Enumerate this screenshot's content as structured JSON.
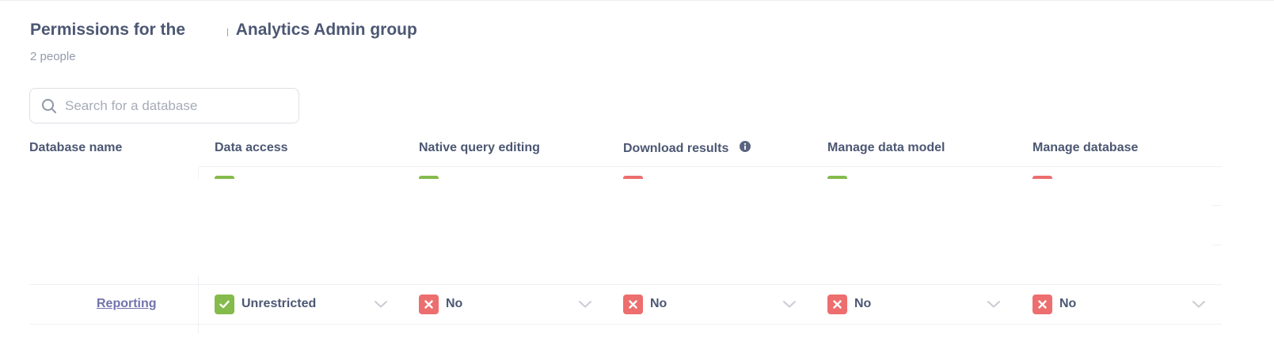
{
  "header": {
    "title_prefix": "Permissions for the",
    "title_group": "Analytics Admin group",
    "subtitle": "2 people"
  },
  "search": {
    "placeholder": "Search for a database",
    "value": ""
  },
  "table": {
    "columns": [
      "Database name",
      "Data access",
      "Native query editing",
      "Download results",
      "Manage data model",
      "Manage database"
    ],
    "partial_row_statuses": [
      "green",
      "green",
      "red",
      "green",
      "red"
    ],
    "rows": [
      {
        "database": "Reporting",
        "cells": [
          {
            "label": "Unrestricted",
            "status": "green"
          },
          {
            "label": "No",
            "status": "red"
          },
          {
            "label": "No",
            "status": "red"
          },
          {
            "label": "No",
            "status": "red"
          },
          {
            "label": "No",
            "status": "red"
          }
        ]
      }
    ]
  },
  "icons": {
    "search": "search-icon",
    "info": "info-icon",
    "check": "check-icon",
    "close": "close-icon",
    "chevron": "chevron-down-icon"
  },
  "colors": {
    "text": "#4c5773",
    "muted": "#949aab",
    "link": "#7172ad",
    "green": "#84bb4c",
    "red": "#ed6e6e",
    "border": "#eef0f3"
  }
}
